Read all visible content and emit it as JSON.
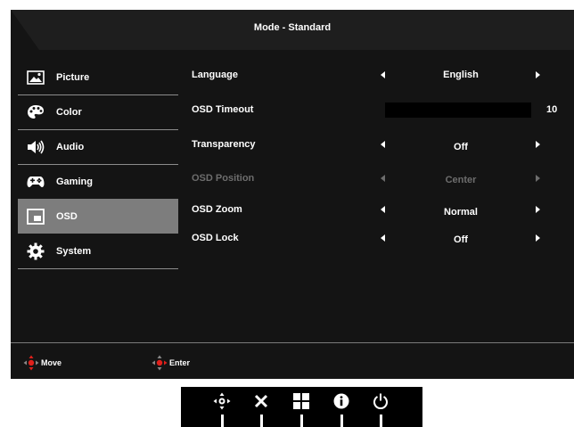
{
  "osd": {
    "title": "Mode - Standard",
    "menu": [
      {
        "label": "Picture",
        "icon": "picture-icon",
        "active": false
      },
      {
        "label": "Color",
        "icon": "palette-icon",
        "active": false
      },
      {
        "label": "Audio",
        "icon": "speaker-icon",
        "active": false
      },
      {
        "label": "Gaming",
        "icon": "gamepad-icon",
        "active": false
      },
      {
        "label": "OSD",
        "icon": "osd-window-icon",
        "active": true
      },
      {
        "label": "System",
        "icon": "gear-icon",
        "active": false
      }
    ],
    "settings": {
      "language": {
        "label": "Language",
        "value": "English"
      },
      "osd_timeout": {
        "label": "OSD Timeout",
        "value": "10"
      },
      "transparency": {
        "label": "Transparency",
        "value": "Off"
      },
      "osd_position": {
        "label": "OSD Position",
        "value": "Center",
        "disabled": true
      },
      "osd_zoom": {
        "label": "OSD Zoom",
        "value": "Normal"
      },
      "osd_lock": {
        "label": "OSD Lock",
        "value": "Off"
      }
    },
    "hints": {
      "move": "Move",
      "enter": "Enter"
    }
  },
  "buttons": [
    {
      "icon": "joystick-icon"
    },
    {
      "icon": "close-icon"
    },
    {
      "icon": "grid-icon"
    },
    {
      "icon": "info-icon"
    },
    {
      "icon": "power-icon"
    }
  ],
  "colors": {
    "panel_bg": "#141414",
    "active_item": "#7d7d7d",
    "disabled_text": "#6d6d6d",
    "hint_accent": "#e0201b"
  }
}
